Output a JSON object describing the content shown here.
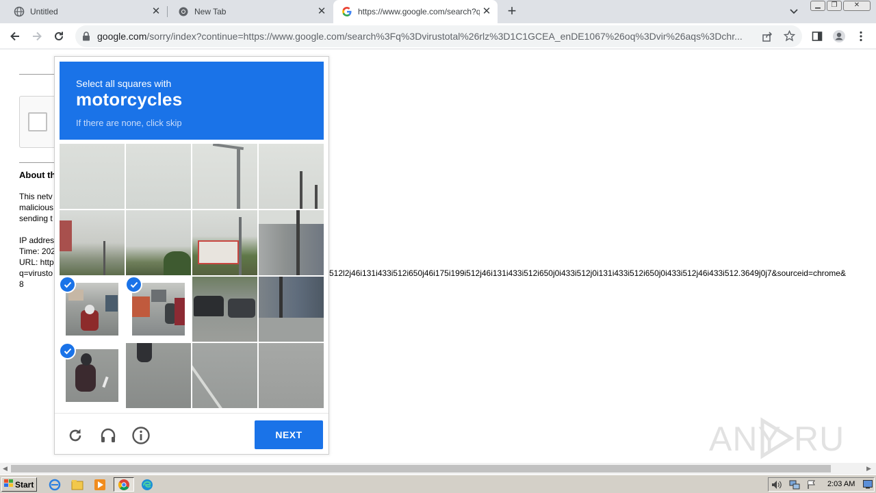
{
  "browser": {
    "tabs": [
      {
        "title": "Untitled",
        "active": false
      },
      {
        "title": "New Tab",
        "active": false
      },
      {
        "title": "https://www.google.com/search?q=",
        "active": true
      }
    ],
    "address_domain": "google.com",
    "address_rest": "/sorry/index?continue=https://www.google.com/search%3Fq%3Dvirustotal%26rlz%3D1C1GCEA_enDE1067%26oq%3Dvir%26aqs%3Dchr..."
  },
  "page": {
    "about_heading": "About th",
    "body_line1": "This netv",
    "body_line2": "malicious",
    "body_line3": "sending t",
    "ip_line": "IP addres",
    "time_line": "Time: 202",
    "url_line": "URL: http",
    "q_line": "q=virusto",
    "q_line_cont": "512l2j46i131i433i512i650j46i175i199i512j46i131i433i512i650j0i433i512j0i131i433i512i650j0i433i512j46i433i512.3649j0j7&sourceid=chrome&",
    "trail": "8"
  },
  "captcha": {
    "instruction": "Select all squares with",
    "object": "motorcycles",
    "hint": "If there are none, click skip",
    "selected_cells": [
      8,
      9,
      12
    ],
    "next_label": "NEXT",
    "icons": [
      "reload-icon",
      "audio-icon",
      "info-icon"
    ]
  },
  "taskbar": {
    "start_label": "Start",
    "clock": "2:03 AM"
  },
  "watermark": "ANY RUN",
  "colors": {
    "accent": "#1a73e8"
  }
}
